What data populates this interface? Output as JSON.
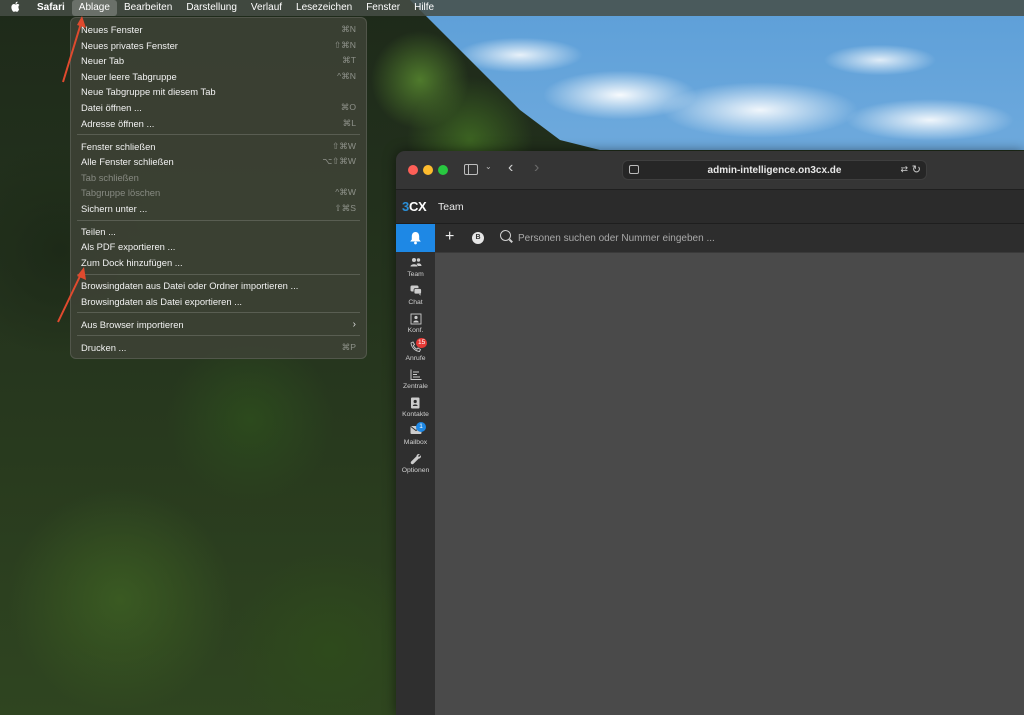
{
  "menubar": {
    "app": "Safari",
    "items": [
      "Ablage",
      "Bearbeiten",
      "Darstellung",
      "Verlauf",
      "Lesezeichen",
      "Fenster",
      "Hilfe"
    ],
    "active": "Ablage"
  },
  "file_menu": {
    "groups": [
      [
        {
          "label": "Neues Fenster",
          "shortcut": "⌘N"
        },
        {
          "label": "Neues privates Fenster",
          "shortcut": "⇧⌘N"
        },
        {
          "label": "Neuer Tab",
          "shortcut": "⌘T"
        },
        {
          "label": "Neuer leere Tabgruppe",
          "shortcut": "^⌘N"
        },
        {
          "label": "Neue Tabgruppe mit diesem Tab",
          "shortcut": ""
        },
        {
          "label": "Datei öffnen ...",
          "shortcut": "⌘O"
        },
        {
          "label": "Adresse öffnen ...",
          "shortcut": "⌘L"
        }
      ],
      [
        {
          "label": "Fenster schließen",
          "shortcut": "⇧⌘W"
        },
        {
          "label": "Alle Fenster schließen",
          "shortcut": "⌥⇧⌘W"
        },
        {
          "label": "Tab schließen",
          "shortcut": "",
          "disabled": true
        },
        {
          "label": "Tabgruppe löschen",
          "shortcut": "^⌘W",
          "disabled": true
        },
        {
          "label": "Sichern unter ...",
          "shortcut": "⇧⌘S"
        }
      ],
      [
        {
          "label": "Teilen ...",
          "shortcut": ""
        },
        {
          "label": "Als PDF exportieren ...",
          "shortcut": ""
        },
        {
          "label": "Zum Dock hinzufügen ...",
          "shortcut": ""
        }
      ],
      [
        {
          "label": "Browsingdaten aus Datei oder Ordner importieren ...",
          "shortcut": ""
        },
        {
          "label": "Browsingdaten als Datei exportieren ...",
          "shortcut": ""
        }
      ],
      [
        {
          "label": "Aus Browser importieren",
          "shortcut": "",
          "submenu": true
        }
      ],
      [
        {
          "label": "Drucken ...",
          "shortcut": "⌘P"
        }
      ]
    ]
  },
  "browser": {
    "url": "admin-intelligence.on3cx.de",
    "app_logo_a": "3",
    "app_logo_b": "CX",
    "app_title": "Team",
    "nav": [
      {
        "id": "team",
        "label": "Team",
        "icon": "team-icon"
      },
      {
        "id": "chat",
        "label": "Chat",
        "icon": "chat-icon"
      },
      {
        "id": "konf",
        "label": "Konf.",
        "icon": "conference-icon"
      },
      {
        "id": "anrufe",
        "label": "Anrufe",
        "icon": "calls-icon",
        "badge": "15",
        "badge_color": "#e53935"
      },
      {
        "id": "zentrale",
        "label": "Zentrale",
        "icon": "switchboard-icon"
      },
      {
        "id": "kontakte",
        "label": "Kontakte",
        "icon": "contacts-icon"
      },
      {
        "id": "mailbox",
        "label": "Mailbox",
        "icon": "mailbox-icon",
        "badge": "1",
        "badge_color": "#1e88e5"
      },
      {
        "id": "optionen",
        "label": "Optionen",
        "icon": "wrench-icon"
      }
    ],
    "status_letter": "B",
    "search_placeholder": "Personen suchen oder Nummer eingeben ..."
  }
}
